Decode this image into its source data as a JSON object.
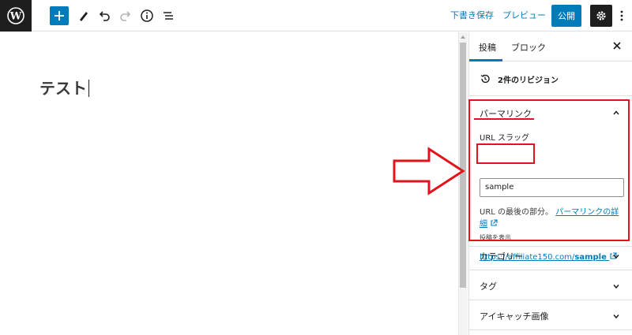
{
  "toolbar": {
    "save_draft": "下書き保存",
    "preview": "プレビュー",
    "publish": "公開"
  },
  "editor": {
    "title": "テスト"
  },
  "sidebar": {
    "tabs": [
      {
        "label": "投稿",
        "active": true
      },
      {
        "label": "ブロック",
        "active": false
      }
    ],
    "revisions": "2件のリビジョン",
    "permalink": {
      "title": "パーマリンク",
      "slug_label": "URL スラッグ",
      "slug_value": "sample",
      "help_prefix": "URL の最後の部分。",
      "help_link": "パーマリンクの詳細",
      "view_label": "投稿を表示",
      "url_prefix": "https://affiliate150.com/",
      "url_slug": "sample"
    },
    "panels": [
      {
        "label": "カテゴリー"
      },
      {
        "label": "タグ"
      },
      {
        "label": "アイキャッチ画像"
      }
    ]
  },
  "colors": {
    "accent": "#007cba",
    "annotation": "#e3121b",
    "dark": "#1e1e1e"
  }
}
